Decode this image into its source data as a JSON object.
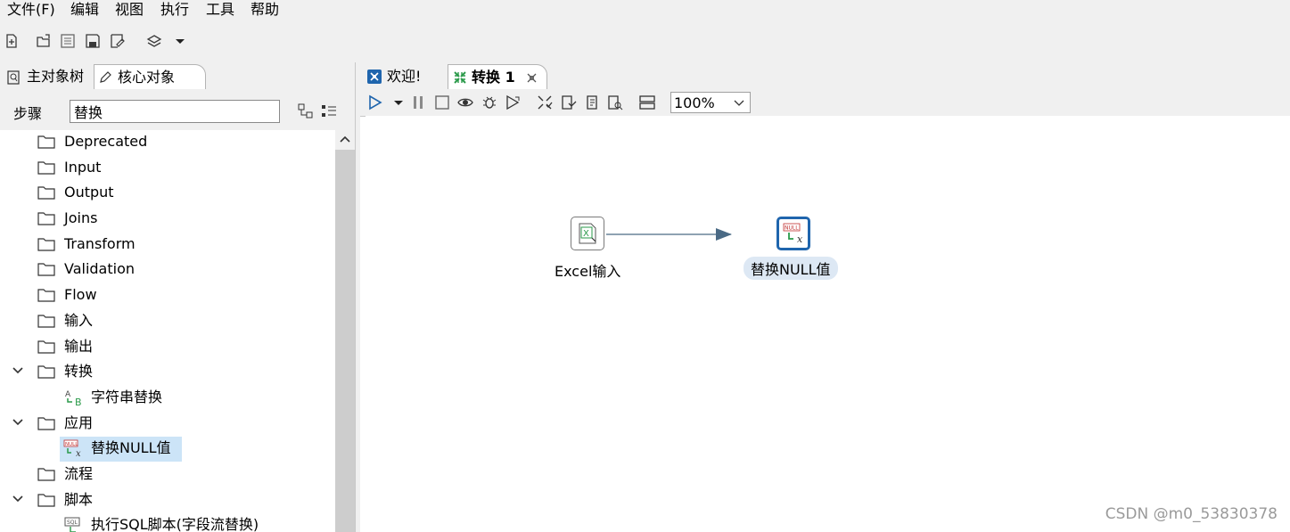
{
  "menu": [
    "文件(F)",
    "编辑",
    "视图",
    "执行",
    "工具",
    "帮助"
  ],
  "left_panel": {
    "tabs": [
      "主对象树",
      "核心对象"
    ],
    "search_label": "步骤",
    "search_value": "替换",
    "tree": [
      {
        "label": "Deprecated",
        "expanded": false
      },
      {
        "label": "Input",
        "expanded": false
      },
      {
        "label": "Output",
        "expanded": false
      },
      {
        "label": "Joins",
        "expanded": false
      },
      {
        "label": "Transform",
        "expanded": false
      },
      {
        "label": "Validation",
        "expanded": false
      },
      {
        "label": "Flow",
        "expanded": false
      },
      {
        "label": "输入",
        "expanded": false
      },
      {
        "label": "输出",
        "expanded": false
      },
      {
        "label": "转换",
        "expanded": true
      },
      {
        "label": "字符串替换",
        "leaf": true
      },
      {
        "label": "应用",
        "expanded": true
      },
      {
        "label": "替换NULL值",
        "leaf": true,
        "selected": true
      },
      {
        "label": "流程",
        "expanded": false
      },
      {
        "label": "脚本",
        "expanded": true
      },
      {
        "label": "执行SQL脚本(字段流替换)",
        "leaf": true
      }
    ]
  },
  "right_panel": {
    "tabs": [
      "欢迎!",
      "转换 1"
    ],
    "zoom": "100%",
    "steps": [
      {
        "label": "Excel输入"
      },
      {
        "label": "替换NULL值",
        "selected": true
      }
    ]
  },
  "watermark": "CSDN @m0_53830378",
  "colors": {
    "accent": "#1f65ad",
    "selection": "#cce4f7",
    "hop": "#4a6a85"
  }
}
